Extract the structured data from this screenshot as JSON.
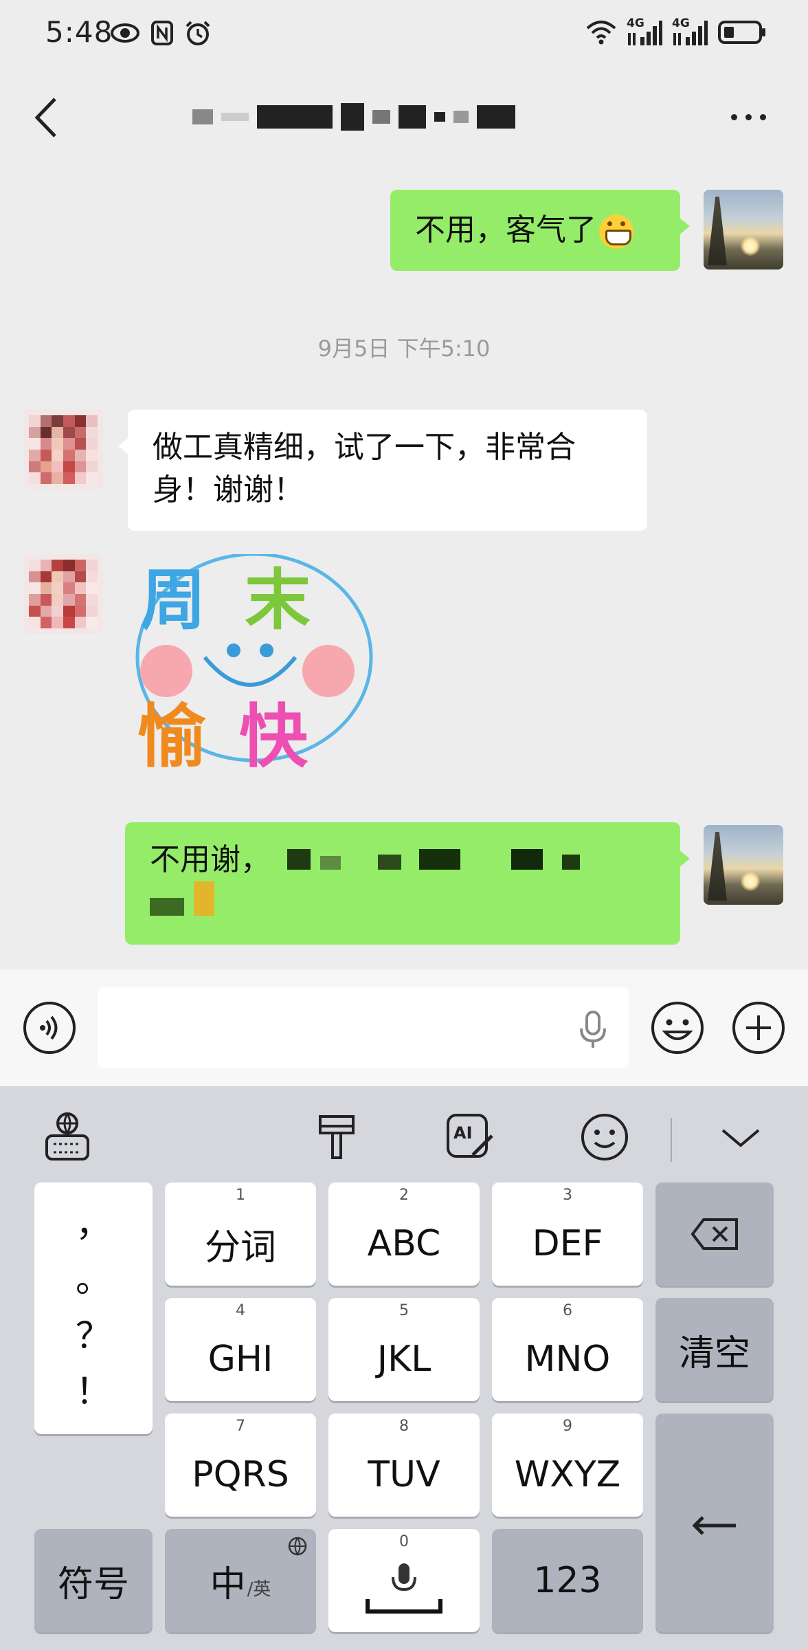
{
  "status_bar": {
    "time": "5:48",
    "network_1": "4G",
    "network_2": "4G"
  },
  "nav": {
    "title": "",
    "back_icon": "chevron-left-icon",
    "more_icon": "more-dots-icon"
  },
  "messages": [
    {
      "side": "self",
      "text": "不用，客气了",
      "emoji": "grin-emoji"
    },
    {
      "side": "other",
      "text": "做工真精细，试了一下，非常合身！谢谢！"
    },
    {
      "side": "other",
      "sticker": {
        "line1": "周末",
        "line2": "愉快"
      }
    },
    {
      "side": "self",
      "text_prefix": "不用谢，"
    }
  ],
  "timestamp": "9月5日 下午5:10",
  "input_bar": {
    "placeholder": "",
    "voice_icon": "voice-icon",
    "emoji_icon": "emoji-icon",
    "plus_icon": "plus-icon"
  },
  "keyboard": {
    "toolbar_icons": [
      "keyboard-globe-icon",
      "brush-icon",
      "ai-write-icon",
      "emoji-icon",
      "collapse-chevron-icon"
    ],
    "punctuation": [
      "，",
      "。",
      "？",
      "！"
    ],
    "keys": [
      {
        "num": "1",
        "label": "分词"
      },
      {
        "num": "2",
        "label": "ABC"
      },
      {
        "num": "3",
        "label": "DEF"
      },
      {
        "num": "4",
        "label": "GHI"
      },
      {
        "num": "5",
        "label": "JKL"
      },
      {
        "num": "6",
        "label": "MNO"
      },
      {
        "num": "7",
        "label": "PQRS"
      },
      {
        "num": "8",
        "label": "TUV"
      },
      {
        "num": "9",
        "label": "WXYZ"
      }
    ],
    "delete_icon": "backspace-icon",
    "clear_label": "清空",
    "enter_icon": "enter-icon",
    "symbols_label": "符号",
    "lang_main": "中",
    "lang_sub": "/英",
    "space_num": "0",
    "numbers_label": "123"
  }
}
